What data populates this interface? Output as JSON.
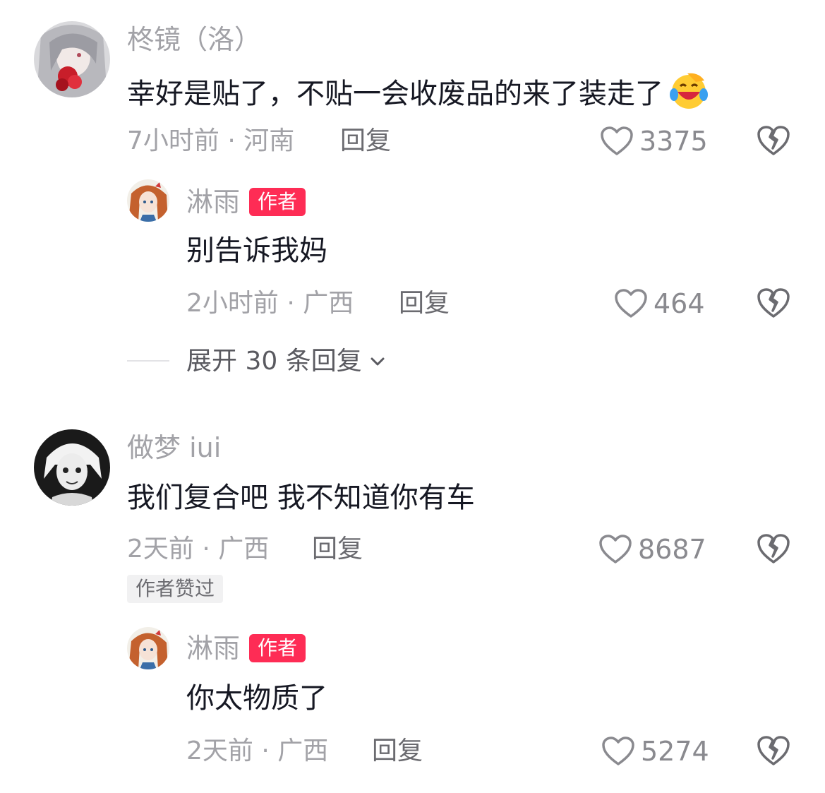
{
  "colors": {
    "name": "#a2a2a7",
    "text": "#161823",
    "badge": "#fe2c55",
    "meta": "#a2a2a7"
  },
  "comments": [
    {
      "username": "柊镜（洛）",
      "text": "幸好是贴了，不贴一会收废品的来了装走了",
      "emoji_icon": "laughing-crying-emoji-icon",
      "meta": "7小时前 · 河南",
      "reply_label": "回复",
      "likes": "3375",
      "replies": [
        {
          "username": "淋雨",
          "badge": "作者",
          "text": "别告诉我妈",
          "meta": "2小时前 · 广西",
          "reply_label": "回复",
          "likes": "464"
        }
      ],
      "expand_label": "展开 30 条回复"
    },
    {
      "username": "做梦 iui",
      "text": "我们复合吧 我不知道你有车",
      "meta": "2天前 · 广西",
      "reply_label": "回复",
      "likes": "8687",
      "liked_by_author": "作者赞过",
      "replies": [
        {
          "username": "淋雨",
          "badge": "作者",
          "text": "你太物质了",
          "meta": "2天前 · 广西",
          "reply_label": "回复",
          "likes": "5274"
        }
      ]
    }
  ]
}
